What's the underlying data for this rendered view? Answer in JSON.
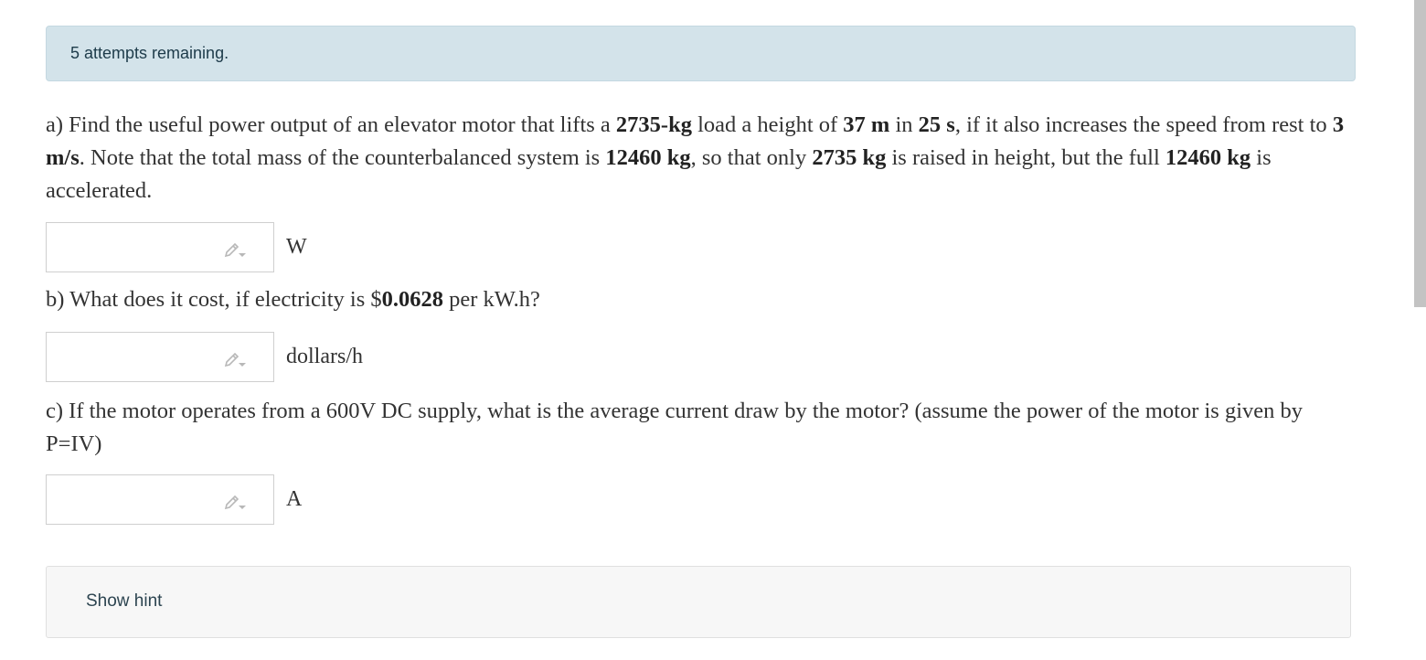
{
  "alert": {
    "text": "5 attempts remaining."
  },
  "question_a": {
    "t1": "a) Find the useful power output of an elevator motor that lifts a ",
    "mass_load": "2735-kg",
    "t2": " load a height of ",
    "height": "37 m",
    "t3": " in ",
    "time": "25 s",
    "t4": ", if it also increases the speed from rest to ",
    "speed": "3 m/s",
    "t5": ". Note that the total mass of the counterbalanced system is ",
    "total_mass": "12460 kg",
    "t6": ", so that only ",
    "raised_mass": "2735 kg",
    "t7": " is raised in height, but the full ",
    "total_mass_2": "12460 kg",
    "t8": " is accelerated.",
    "unit": "W",
    "answer_value": ""
  },
  "question_b": {
    "t1": "b) What does it cost, if electricity is $",
    "price": "0.0628",
    "t2": " per kW.h?",
    "unit": "dollars/h",
    "answer_value": ""
  },
  "question_c": {
    "text": "c) If the motor operates from a 600V DC supply, what is the average current draw by the motor? (assume the power of the motor is given by P=IV)",
    "unit": "A",
    "answer_value": ""
  },
  "hint": {
    "label": "Show hint"
  },
  "icons": {
    "answer_input_icon": "pencil-icon"
  },
  "colors": {
    "alert_bg": "#d3e3ea",
    "alert_text": "#1d3b4a",
    "hint_bg": "#f7f7f7",
    "body_text": "#333333"
  }
}
